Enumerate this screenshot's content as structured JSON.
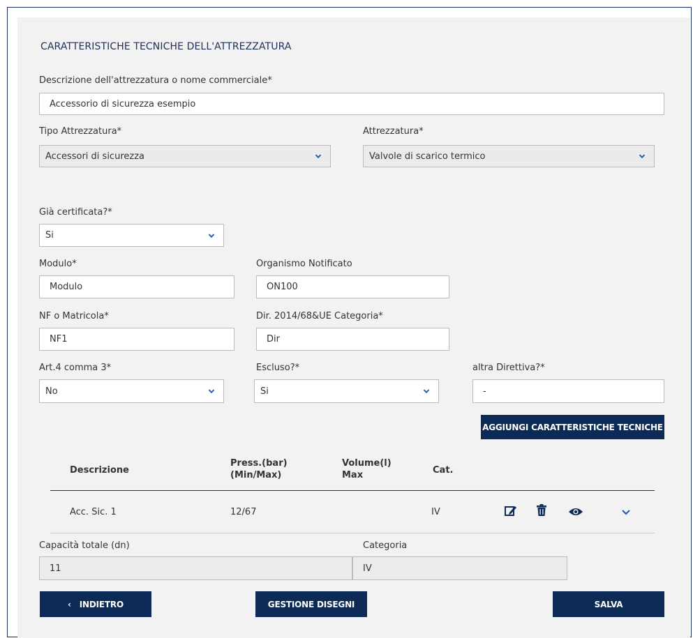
{
  "section": {
    "title": "CARATTERISTICHE TECNICHE DELL'ATTREZZATURA"
  },
  "fields": {
    "descrizione": {
      "label": "Descrizione dell'attrezzatura o nome commerciale*",
      "value": "Accessorio di sicurezza esempio"
    },
    "tipo_attrezzatura": {
      "label": "Tipo Attrezzatura*",
      "value": "Accessori di sicurezza"
    },
    "attrezzatura": {
      "label": "Attrezzatura*",
      "value": "Valvole di scarico termico"
    },
    "gia_certificata": {
      "label": "Già certificata?*",
      "value": "Si"
    },
    "modulo": {
      "label": "Modulo*",
      "value": "Modulo"
    },
    "organismo_notificato": {
      "label": "Organismo Notificato",
      "value": "ON100"
    },
    "nf_matricola": {
      "label": "NF o Matricola*",
      "value": "NF1"
    },
    "dir_categoria": {
      "label": "Dir. 2014/68&UE Categoria*",
      "value": "Dir"
    },
    "art4_comma3": {
      "label": "Art.4 comma 3*",
      "value": "No"
    },
    "escluso": {
      "label": "Escluso?*",
      "value": "Si"
    },
    "altra_direttiva": {
      "label": "altra Direttiva?*",
      "value": "-"
    }
  },
  "buttons": {
    "aggiungi": "AGGIUNGI CARATTERISTICHE TECNICHE",
    "indietro": "INDIETRO",
    "gestione_disegni": "GESTIONE DISEGNI",
    "salva": "SALVA"
  },
  "table": {
    "headers": {
      "descrizione": "Descrizione",
      "press_line1": "Press.(bar)",
      "press_line2": "(Min/Max)",
      "volume_line1": "Volume(l)",
      "volume_line2": "Max",
      "cat": "Cat."
    },
    "rows": [
      {
        "descrizione": "Acc. Sic. 1",
        "press": "12/67",
        "volume": "",
        "cat": "IV"
      }
    ]
  },
  "totals": {
    "capacita": {
      "label": "Capacità totale (dn)",
      "value": "11"
    },
    "categoria": {
      "label": "Categoria",
      "value": "IV"
    }
  },
  "icons": {
    "edit": "edit-icon",
    "delete": "trash-icon",
    "view": "eye-icon",
    "expand": "chevron-down-icon",
    "back": "chevron-left-icon"
  },
  "colors": {
    "primary": "#0b2a55",
    "title": "#1c2f5c",
    "chevron": "#2e5fa6",
    "panel": "#f2f2f2"
  }
}
